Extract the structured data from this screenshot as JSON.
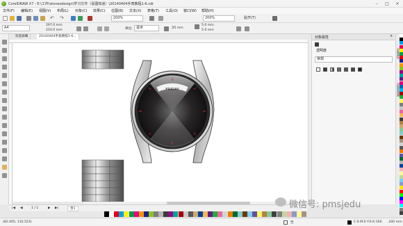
{
  "window": {
    "title": "CorelDRAW X7 - E:\\工作\\stonesdesign\\学习文件（喜图知道）\\20140404手表教程1-6.cdr",
    "controls": [
      "–",
      "□",
      "×"
    ]
  },
  "menu": [
    "文件(F)",
    "编辑(E)",
    "视图(V)",
    "布局(L)",
    "对象(C)",
    "效果(C)",
    "位图(B)",
    "文本(X)",
    "表格(T)",
    "工具(O)",
    "窗口(W)",
    "帮助(H)"
  ],
  "toolbar": {
    "zoom_left": "200%",
    "zoom_right": "200%",
    "snap_label": "贴齐(T)"
  },
  "propbar": {
    "page_size": "A4",
    "width": "297.0 mm",
    "height": "210.0 mm",
    "units_label": "单位:",
    "units_value": "毫米",
    "nudge": ".05 mm",
    "dup_x": "5.0 mm",
    "dup_y": "5.0 mm"
  },
  "tabs": [
    "欢迎屏幕",
    "20140404手表教程1-6..."
  ],
  "canvas": {
    "watch_day": "FRIDAY"
  },
  "pages": {
    "current": "1",
    "total": "1",
    "label": "1 / 1",
    "page_tab": "页1"
  },
  "docker": {
    "title": "对象属性",
    "section": "透明度",
    "mode_value": "常规"
  },
  "sidetabs": [
    "对象属性",
    "对象管理器"
  ],
  "status": {
    "coords": "(82.005, 110.523)",
    "fill_label": "无",
    "color_info": "C:0 M:0 Y:0 K:100",
    "stroke_width": ".200 mm"
  },
  "watermark": {
    "text": "微信号: pmsjedu"
  },
  "colors": {
    "accent_red": "#e0262a",
    "dial_dark": "#1a1618",
    "metal_light": "#eeeeee"
  }
}
